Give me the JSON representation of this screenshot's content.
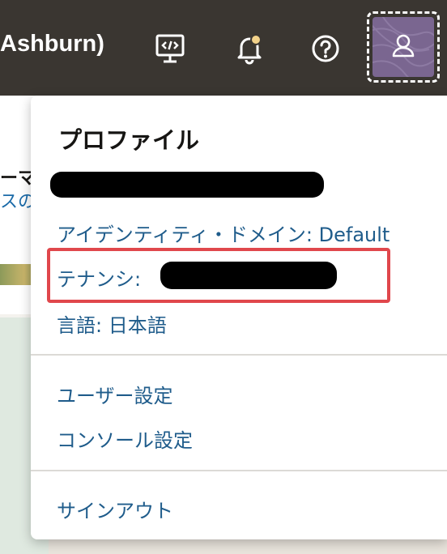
{
  "topbar": {
    "region_text": "Ashburn)",
    "icons": [
      "developer-tools-icon",
      "bell-icon",
      "help-icon",
      "user-icon"
    ]
  },
  "background": {
    "text1": "ーマ",
    "text2": "スの"
  },
  "profile_menu": {
    "title": "プロファイル",
    "identity_domain": "アイデンティティ・ドメイン: Default",
    "tenancy_label": "テナンシ:",
    "language": "言語: 日本語",
    "user_settings": "ユーザー設定",
    "console_settings": "コンソール設定",
    "sign_out": "サインアウト"
  },
  "colors": {
    "topbar": "#3a3631",
    "link": "#1f5c8b",
    "highlight": "#e0474c",
    "avatar": "#7a6690",
    "notification_dot": "#f2d28a"
  }
}
